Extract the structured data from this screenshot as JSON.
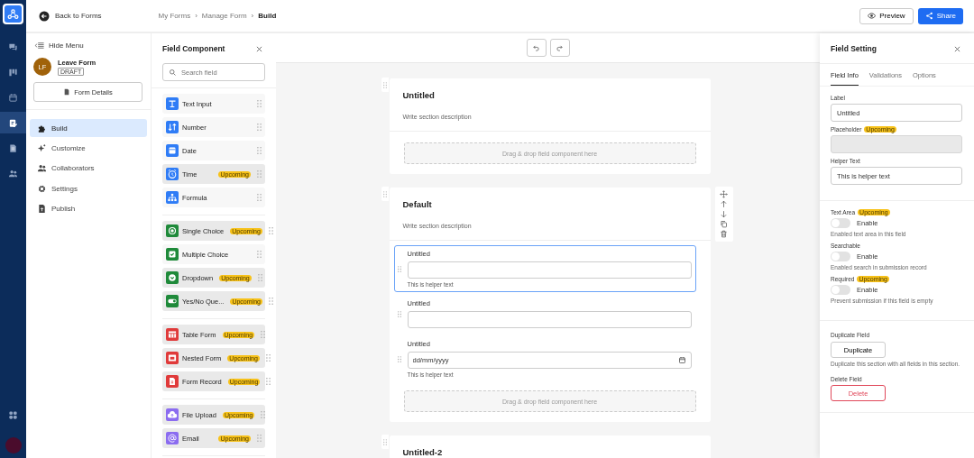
{
  "rail": {
    "items": [
      {
        "selected": false
      },
      {
        "selected": false
      },
      {
        "selected": false
      },
      {
        "selected": true
      },
      {
        "selected": false
      },
      {
        "selected": false
      }
    ]
  },
  "header": {
    "back": "Back to Forms",
    "breadcrumbs": [
      {
        "label": "My Forms",
        "current": false
      },
      {
        "separator": "›",
        "label": "Manage Form",
        "current": false
      },
      {
        "separator": "›",
        "label": "Build",
        "current": true
      }
    ],
    "preview": "Preview",
    "share": "Share"
  },
  "menu": {
    "hide": "Hide Menu",
    "form": {
      "initials": "LF",
      "name": "Leave Form",
      "status": "DRAFT"
    },
    "details": "Form Details",
    "nav": [
      {
        "label": "Build",
        "selected": true
      },
      {
        "label": "Customize",
        "selected": false
      },
      {
        "label": "Collaborators",
        "selected": false
      },
      {
        "label": "Settings",
        "selected": false
      },
      {
        "label": "Publish",
        "selected": false
      }
    ]
  },
  "components": {
    "title": "Field Component",
    "search_placeholder": "Search field",
    "groups": [
      {
        "color": "#2f7cf6",
        "items": [
          {
            "label": "Text Input"
          },
          {
            "label": "Number"
          },
          {
            "label": "Date"
          },
          {
            "label": "Time",
            "badge": "Upcoming"
          },
          {
            "label": "Formula"
          }
        ]
      },
      {
        "color": "#1f8a3a",
        "items": [
          {
            "label": "Single Choice",
            "badge": "Upcoming"
          },
          {
            "label": "Multiple Choice"
          },
          {
            "label": "Dropdown",
            "badge": "Upcoming"
          },
          {
            "label": "Yes/No Que...",
            "badge": "Upcoming"
          }
        ]
      },
      {
        "color": "#e03a3a",
        "items": [
          {
            "label": "Table Form",
            "badge": "Upcoming"
          },
          {
            "label": "Nested Form",
            "badge": "Upcoming"
          },
          {
            "label": "Form Record",
            "badge": "Upcoming"
          }
        ]
      },
      {
        "color": "#8b6cf0",
        "items": [
          {
            "label": "File Upload",
            "badge": "Upcoming"
          },
          {
            "label": "Email",
            "badge": "Upcoming"
          }
        ]
      }
    ]
  },
  "canvas": {
    "sections": [
      {
        "title": "Untitled",
        "description": "Write section description",
        "active": false,
        "dropzone": "Drag & drop field component here"
      },
      {
        "title": "Default",
        "description": "Write section description",
        "active": true,
        "fields": [
          {
            "kind": "text",
            "label": "Untitled",
            "helper": "This is helper text",
            "selected": true
          },
          {
            "kind": "text",
            "label": "Untitled",
            "selected": false
          },
          {
            "kind": "date",
            "label": "Untitled",
            "placeholder": "dd/mm/yyyy",
            "helper": "This is helper text",
            "selected": false
          }
        ],
        "dropzone": "Drag & drop field component here"
      },
      {
        "title": "Untitled-2",
        "active": false
      }
    ]
  },
  "settings": {
    "title": "Field Setting",
    "tabs": [
      {
        "label": "Field Info",
        "selected": true
      },
      {
        "label": "Validations",
        "selected": false
      },
      {
        "label": "Options",
        "selected": false
      }
    ],
    "inputs": [
      {
        "label": "Label",
        "value": "Untitled",
        "disabled": false
      },
      {
        "label": "Placeholder",
        "badge": "Upcoming",
        "disabled": true
      },
      {
        "label": "Helper Text",
        "value": "This is helper text",
        "disabled": false
      }
    ],
    "toggles": [
      {
        "label": "Text Area",
        "badge": "Upcoming",
        "on": false,
        "text": "Enable",
        "hint": "Enabled text area in this field"
      },
      {
        "label": "Searchable",
        "on": false,
        "text": "Enable",
        "hint": "Enabled search in submission record"
      },
      {
        "label": "Required",
        "badge": "Upcoming",
        "on": false,
        "text": "Enable",
        "hint": "Prevent submission if this field is empty"
      }
    ],
    "duplicate": {
      "label": "Duplicate Field",
      "button": "Duplicate",
      "hint": "Duplicate this section with all fields in this section."
    },
    "delete": {
      "label": "Delete Field",
      "button": "Delete"
    }
  }
}
